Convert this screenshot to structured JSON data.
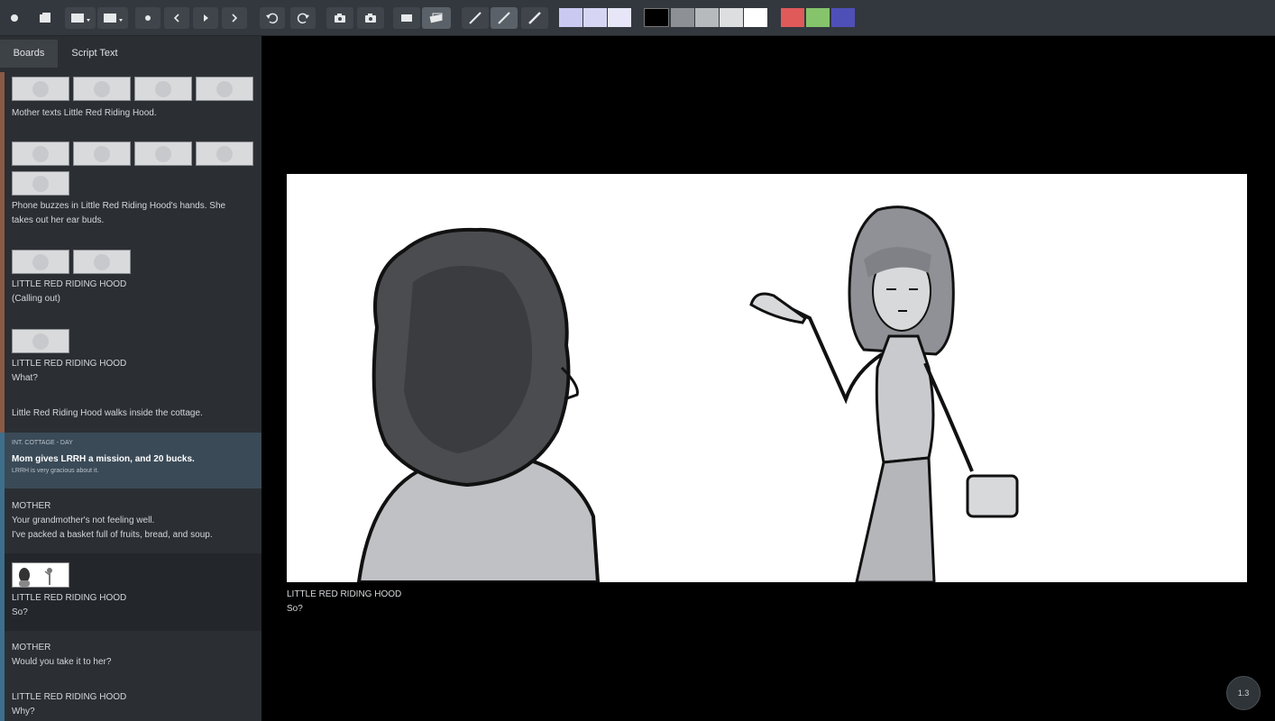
{
  "toolbar": {
    "tools": [
      "record-icon",
      "board-icon",
      "add-board-icon",
      "duplicate-board-icon",
      "dot-icon",
      "chevron-left-icon",
      "play-icon",
      "chevron-right-icon",
      "undo-icon",
      "redo-icon",
      "camera-icon",
      "camera-alt-icon",
      "light-table-icon",
      "onion-skin-icon",
      "pencil-icon",
      "pen-icon",
      "brush-icon"
    ],
    "tone_swatches": [
      "#c9c9f2",
      "#d6d6f4",
      "#e6e6f8"
    ],
    "gray_swatches": [
      "#000000",
      "#8d9196",
      "#b7babd",
      "#dcdee0",
      "#ffffff"
    ],
    "color_swatches": [
      "#e05a5a",
      "#86c46c",
      "#4f4fb8"
    ]
  },
  "sidebar": {
    "tabs": [
      "Boards",
      "Script Text"
    ],
    "items": [
      {
        "text": "Mother texts Little Red Riding Hood."
      },
      {
        "line1": "Phone buzzes in Little Red Riding Hood's hands. She",
        "line2": "takes out her ear buds."
      },
      {
        "line1": "LITTLE RED RIDING HOOD",
        "line2": "(Calling out)"
      },
      {
        "line1": "LITTLE RED RIDING HOOD",
        "line2": "What?"
      },
      {
        "text": "Little Red Riding Hood walks inside the cottage."
      },
      {
        "scene": "INT. COTTAGE - DAY",
        "title": "Mom gives LRRH a mission, and 20 bucks.",
        "desc": "LRRH is very gracious about it."
      },
      {
        "line1": "MOTHER",
        "line2": "Your grandmother's not feeling well.",
        "line3": "I've packed a basket full of fruits, bread, and soup."
      },
      {
        "line1": "LITTLE RED RIDING HOOD",
        "line2": "So?"
      },
      {
        "line1": "MOTHER",
        "line2": "Would you take it to her?"
      },
      {
        "line1": "LITTLE RED RIDING HOOD",
        "line2": "Why?"
      }
    ]
  },
  "main": {
    "caption_line1": "LITTLE RED RIDING HOOD",
    "caption_line2": "So?",
    "zoom": "1.3"
  }
}
